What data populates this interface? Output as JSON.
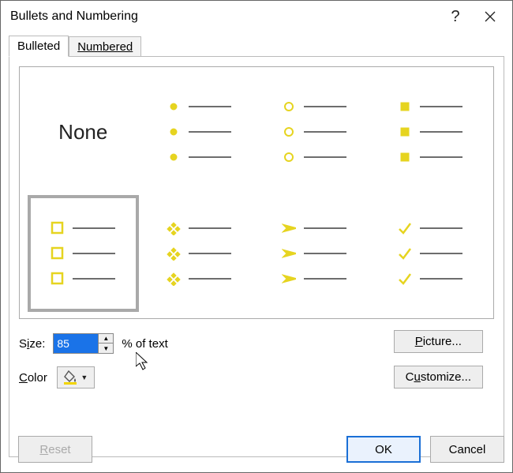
{
  "title": "Bullets and Numbering",
  "tabs": {
    "bulleted": "Bulleted",
    "numbered": "Numbered"
  },
  "gallery": {
    "none": "None"
  },
  "size": {
    "label_pre": "S",
    "label_u": "i",
    "label_post": "ze:",
    "value": "85",
    "suffix": "% of text"
  },
  "color": {
    "label": "Color"
  },
  "buttons": {
    "picture_pre": "",
    "picture_u": "P",
    "picture_post": "icture...",
    "customize_pre": "C",
    "customize_u": "u",
    "customize_post": "stomize...",
    "reset_pre": "",
    "reset_u": "R",
    "reset_post": "eset",
    "ok": "OK",
    "cancel": "Cancel"
  },
  "accent_color": "#e6d420"
}
